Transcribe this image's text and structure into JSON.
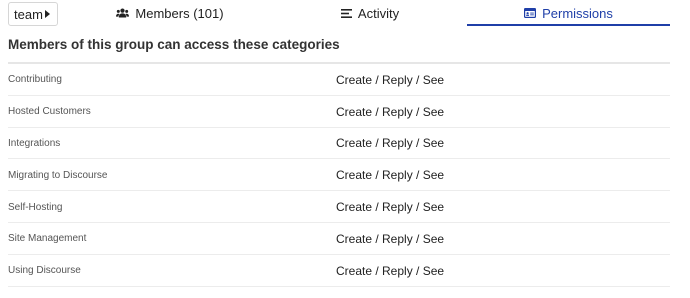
{
  "group_selector": {
    "label": "team"
  },
  "tabs": [
    {
      "label": "Members (101)",
      "icon": "users-icon"
    },
    {
      "label": "Activity",
      "icon": "list-icon"
    },
    {
      "label": "Permissions",
      "icon": "id-card-icon",
      "active": true
    }
  ],
  "heading": "Members of this group can access these categories",
  "categories": [
    {
      "name": "Contributing",
      "permission": "Create / Reply / See"
    },
    {
      "name": "Hosted Customers",
      "permission": "Create / Reply / See"
    },
    {
      "name": "Integrations",
      "permission": "Create / Reply / See"
    },
    {
      "name": "Migrating to Discourse",
      "permission": "Create / Reply / See"
    },
    {
      "name": "Self-Hosting",
      "permission": "Create / Reply / See"
    },
    {
      "name": "Site Management",
      "permission": "Create / Reply / See"
    },
    {
      "name": "Using Discourse",
      "permission": "Create / Reply / See"
    }
  ],
  "colors": {
    "accent": "#1f3fa8",
    "divider": "#ececec",
    "text": "#222222"
  }
}
